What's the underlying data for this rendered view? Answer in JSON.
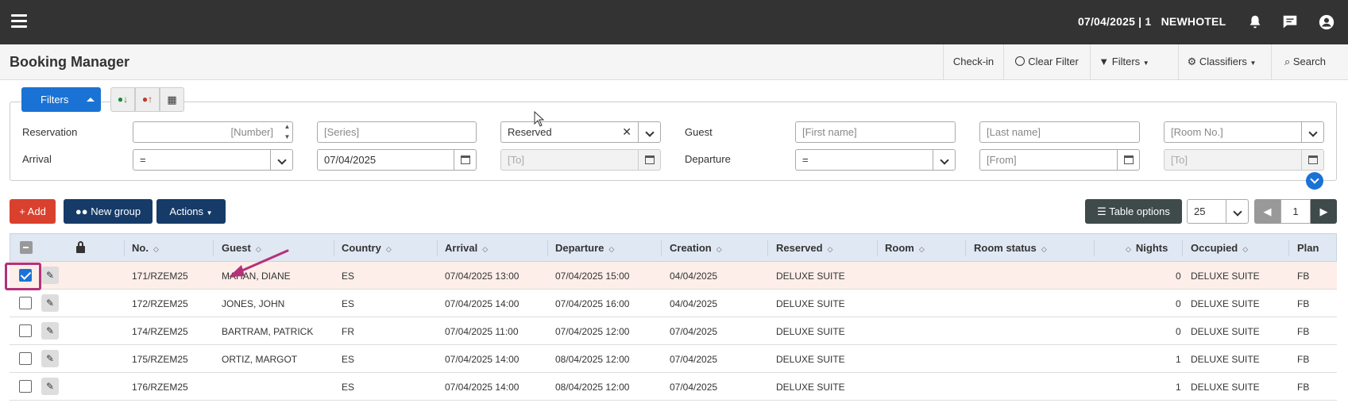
{
  "topbar": {
    "hotel_info": "07/04/2025 | 1   NEWHOTEL",
    "icons": [
      "menu-icon",
      "bell-icon",
      "chat-icon",
      "user-icon"
    ]
  },
  "titlebar": {
    "title": "Booking Manager",
    "buttons": {
      "checkin": "Check-in",
      "clear_filter": "Clear Filter",
      "filters": "Filters",
      "classifiers": "Classifiers",
      "search": "Search"
    }
  },
  "filters": {
    "tab_label": "Filters",
    "reservation_label": "Reservation",
    "number_placeholder": "[Number]",
    "series_placeholder": "[Series]",
    "status_value": "Reserved",
    "guest_label": "Guest",
    "first_name_placeholder": "[First name]",
    "last_name_placeholder": "[Last name]",
    "room_no_placeholder": "[Room No.]",
    "arrival_label": "Arrival",
    "arrival_op": "=",
    "arrival_date": "07/04/2025",
    "arrival_to_placeholder": "[To]",
    "departure_label": "Departure",
    "departure_op": "=",
    "departure_from_placeholder": "[From]",
    "departure_to_placeholder": "[To]"
  },
  "actions": {
    "add": "+ Add",
    "new_group": "New group",
    "actions": "Actions",
    "table_options": "Table options",
    "page_size": "25",
    "page": "1"
  },
  "table": {
    "headers": {
      "no": "No.",
      "guest": "Guest",
      "country": "Country",
      "arrival": "Arrival",
      "departure": "Departure",
      "creation": "Creation",
      "reserved": "Reserved",
      "room": "Room",
      "room_status": "Room status",
      "nights": "Nights",
      "occupied": "Occupied",
      "plan": "Plan"
    },
    "rows": [
      {
        "no": "171/RZEM25",
        "guest": "MAHAN, DIANE",
        "country": "ES",
        "arrival": "07/04/2025 13:00",
        "departure": "07/04/2025 15:00",
        "creation": "04/04/2025",
        "reserved": "DELUXE SUITE",
        "nights": "0",
        "occupied": "DELUXE SUITE",
        "plan": "FB"
      },
      {
        "no": "172/RZEM25",
        "guest": "JONES, JOHN",
        "country": "ES",
        "arrival": "07/04/2025 14:00",
        "departure": "07/04/2025 16:00",
        "creation": "04/04/2025",
        "reserved": "DELUXE SUITE",
        "nights": "0",
        "occupied": "DELUXE SUITE",
        "plan": "FB"
      },
      {
        "no": "174/RZEM25",
        "guest": "BARTRAM, PATRICK",
        "country": "FR",
        "arrival": "07/04/2025 11:00",
        "departure": "07/04/2025 12:00",
        "creation": "07/04/2025",
        "reserved": "DELUXE SUITE",
        "nights": "0",
        "occupied": "DELUXE SUITE",
        "plan": "FB"
      },
      {
        "no": "175/RZEM25",
        "guest": "ORTIZ, MARGOT",
        "country": "ES",
        "arrival": "07/04/2025 14:00",
        "departure": "08/04/2025 12:00",
        "creation": "07/04/2025",
        "reserved": "DELUXE SUITE",
        "nights": "1",
        "occupied": "DELUXE SUITE",
        "plan": "FB"
      },
      {
        "no": "176/RZEM25",
        "guest": "",
        "country": "ES",
        "arrival": "07/04/2025 14:00",
        "departure": "08/04/2025 12:00",
        "creation": "07/04/2025",
        "reserved": "DELUXE SUITE",
        "nights": "1",
        "occupied": "DELUXE SUITE",
        "plan": "FB"
      }
    ]
  },
  "colors": {
    "topbar": "#333333",
    "primary": "#1a73d4",
    "add": "#d9412e",
    "navy": "#163b68",
    "table_options": "#3f4a4a",
    "highlight": "#b5307a"
  }
}
